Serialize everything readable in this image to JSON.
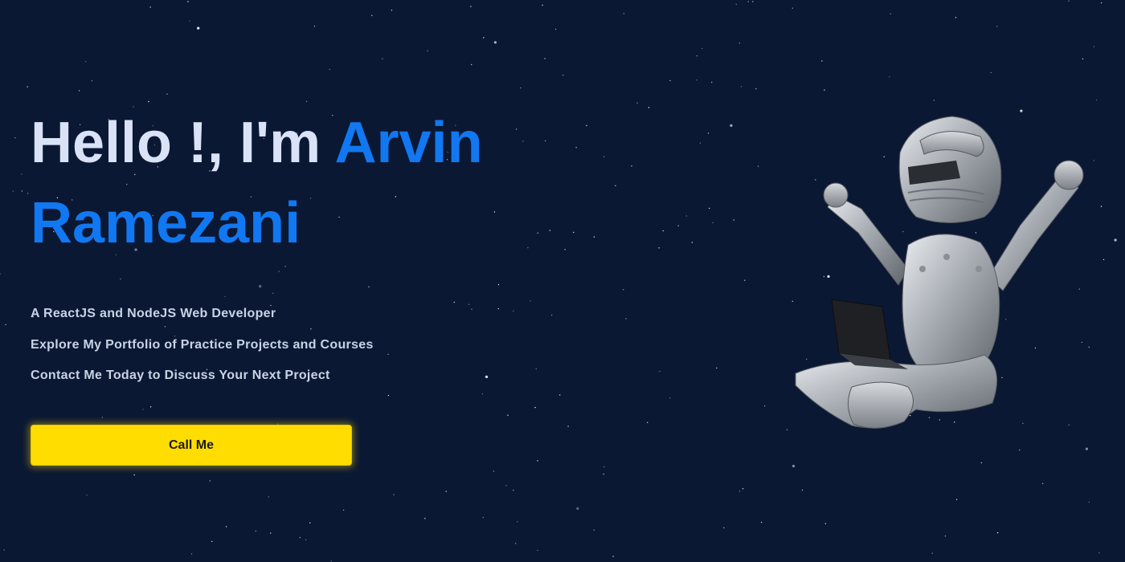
{
  "hero": {
    "greeting": "Hello !, I'm ",
    "name_first": "Arvin",
    "name_last": "Ramezani"
  },
  "taglines": [
    "A ReactJS and NodeJS Web Developer",
    "Explore My Portfolio of Practice Projects and Courses",
    "Contact Me Today to Discuss Your Next Project"
  ],
  "cta": {
    "label": "Call Me"
  },
  "colors": {
    "background": "#0b1833",
    "heading": "#d9e2f6",
    "accent": "#1178f2",
    "body_text": "#c9d3e6",
    "button": "#ffdd00",
    "button_text": "#1b1b1b"
  },
  "illustration": {
    "icon": "knight-astronaut-with-laptop-illustration"
  }
}
